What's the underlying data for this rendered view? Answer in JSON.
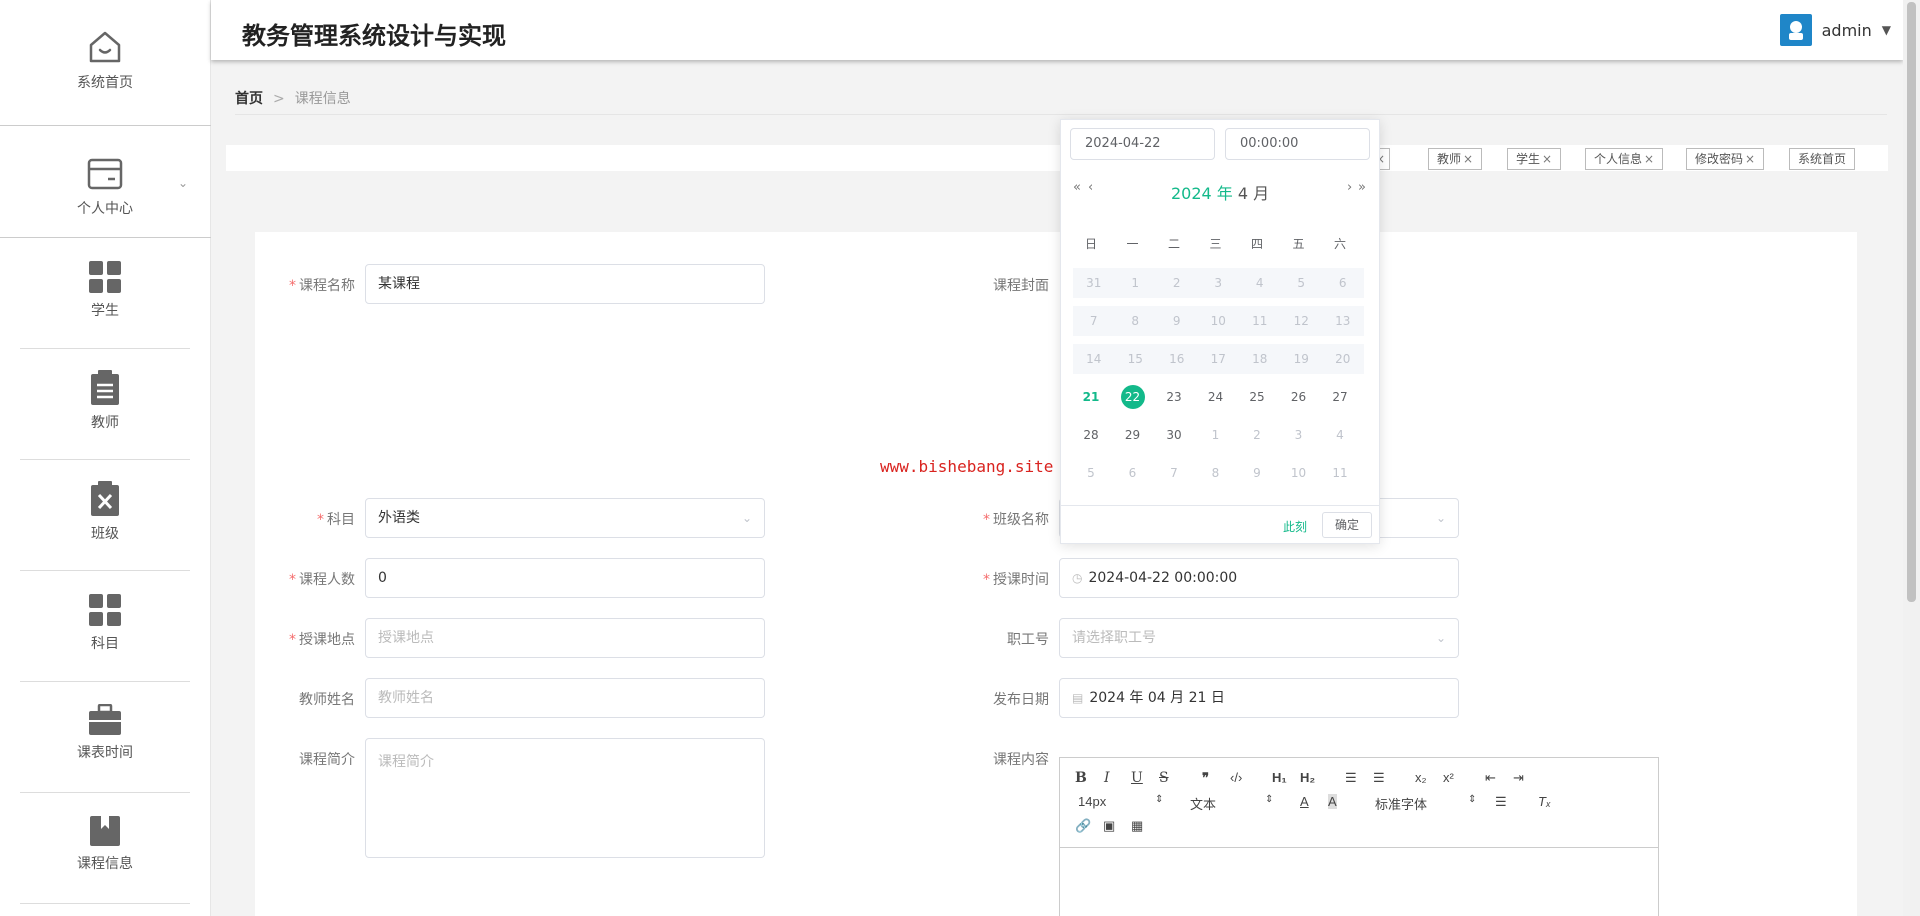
{
  "app": {
    "title": "教务管理系统设计与实现",
    "user": "admin"
  },
  "sidebar": {
    "items": [
      {
        "label": "系统首页",
        "icon": "home-icon"
      },
      {
        "label": "个人中心",
        "icon": "card-icon"
      },
      {
        "label": "学生",
        "icon": "grid-icon"
      },
      {
        "label": "教师",
        "icon": "clipboard-icon"
      },
      {
        "label": "班级",
        "icon": "clipboard-x-icon"
      },
      {
        "label": "科目",
        "icon": "grid-icon"
      },
      {
        "label": "课表时间",
        "icon": "briefcase-icon"
      },
      {
        "label": "课程信息",
        "icon": "book-icon"
      }
    ]
  },
  "breadcrumb": {
    "home": "首页",
    "separator": ">",
    "current": "课程信息"
  },
  "tags": [
    {
      "label": ""
    },
    {
      "label": "教师"
    },
    {
      "label": "学生"
    },
    {
      "label": "个人信息"
    },
    {
      "label": "修改密码"
    },
    {
      "label": "系统首页"
    }
  ],
  "tag_close": "×",
  "form": {
    "course_name": {
      "label": "课程名称",
      "value": "某课程"
    },
    "cover": {
      "label": "课程封面"
    },
    "subject": {
      "label": "科目",
      "value": "外语类"
    },
    "class_name": {
      "label": "班级名称"
    },
    "student_count": {
      "label": "课程人数",
      "value": "0"
    },
    "lesson_time": {
      "label": "授课时间",
      "value": "2024-04-22 00:00:00"
    },
    "location": {
      "label": "授课地点",
      "placeholder": "授课地点"
    },
    "staff_no": {
      "label": "职工号",
      "placeholder": "请选择职工号"
    },
    "teacher_name": {
      "label": "教师姓名",
      "placeholder": "教师姓名"
    },
    "publish_date": {
      "label": "发布日期",
      "value": "2024 年 04 月 21 日"
    },
    "intro": {
      "label": "课程简介",
      "placeholder": "课程简介"
    },
    "content": {
      "label": "课程内容"
    },
    "required_mark": "*"
  },
  "watermark": "www.bishebang.site",
  "editor": {
    "font_size": "14px",
    "block": "文本",
    "font": "标准字体"
  },
  "picker": {
    "date": "2024-04-22",
    "time": "00:00:00",
    "year_label": "2024 年",
    "month_label": "4 月",
    "weekdays": [
      "日",
      "一",
      "二",
      "三",
      "四",
      "五",
      "六"
    ],
    "weeks": [
      [
        "31",
        "1",
        "2",
        "3",
        "4",
        "5",
        "6"
      ],
      [
        "7",
        "8",
        "9",
        "10",
        "11",
        "12",
        "13"
      ],
      [
        "14",
        "15",
        "16",
        "17",
        "18",
        "19",
        "20"
      ],
      [
        "21",
        "22",
        "23",
        "24",
        "25",
        "26",
        "27"
      ],
      [
        "28",
        "29",
        "30",
        "1",
        "2",
        "3",
        "4"
      ],
      [
        "5",
        "6",
        "7",
        "8",
        "9",
        "10",
        "11"
      ]
    ],
    "today": "21",
    "selected": "22",
    "now_label": "此刻",
    "confirm_label": "确定"
  },
  "colors": {
    "accent": "#13b98a",
    "required": "#f56c6c",
    "watermark": "#d9231f",
    "avatar": "#1f86c8"
  }
}
